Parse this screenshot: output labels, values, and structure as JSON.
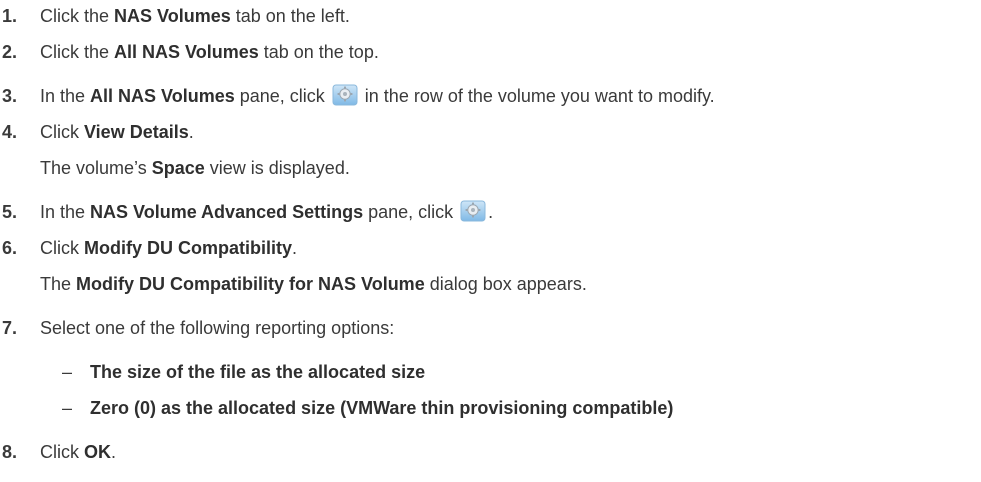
{
  "steps": [
    {
      "number": "1.",
      "parts": [
        "Click the ",
        "NAS Volumes",
        " tab on the left."
      ]
    },
    {
      "number": "2.",
      "parts": [
        "Click the ",
        "All NAS Volumes",
        " tab on the top."
      ]
    },
    {
      "number": "3.",
      "parts": [
        "In the ",
        "All NAS Volumes",
        " pane, click ",
        " in the row of the volume you want to modify."
      ]
    },
    {
      "number": "4.",
      "parts": [
        "Click ",
        "View Details",
        "."
      ],
      "result": [
        "The volume’s ",
        "Space",
        " view is displayed."
      ]
    },
    {
      "number": "5.",
      "parts": [
        "In the ",
        "NAS Volume Advanced Settings",
        " pane, click ",
        "."
      ]
    },
    {
      "number": "6.",
      "parts": [
        "Click ",
        "Modify DU Compatibility",
        "."
      ],
      "result": [
        "The ",
        "Modify DU Compatibility for NAS Volume",
        " dialog box appears."
      ]
    },
    {
      "number": "7.",
      "parts": [
        "Select one of the following reporting options:"
      ],
      "options": [
        "The size of the file as the allocated size",
        "Zero (0) as the allocated size (VMWare thin provisioning compatible)"
      ],
      "dash": "–"
    },
    {
      "number": "8.",
      "parts": [
        "Click ",
        "OK",
        "."
      ]
    }
  ],
  "icons": {
    "gear": "gear-icon"
  },
  "colors": {
    "text": "#3a3a3a",
    "icon_blue": "#5ea8e0"
  }
}
